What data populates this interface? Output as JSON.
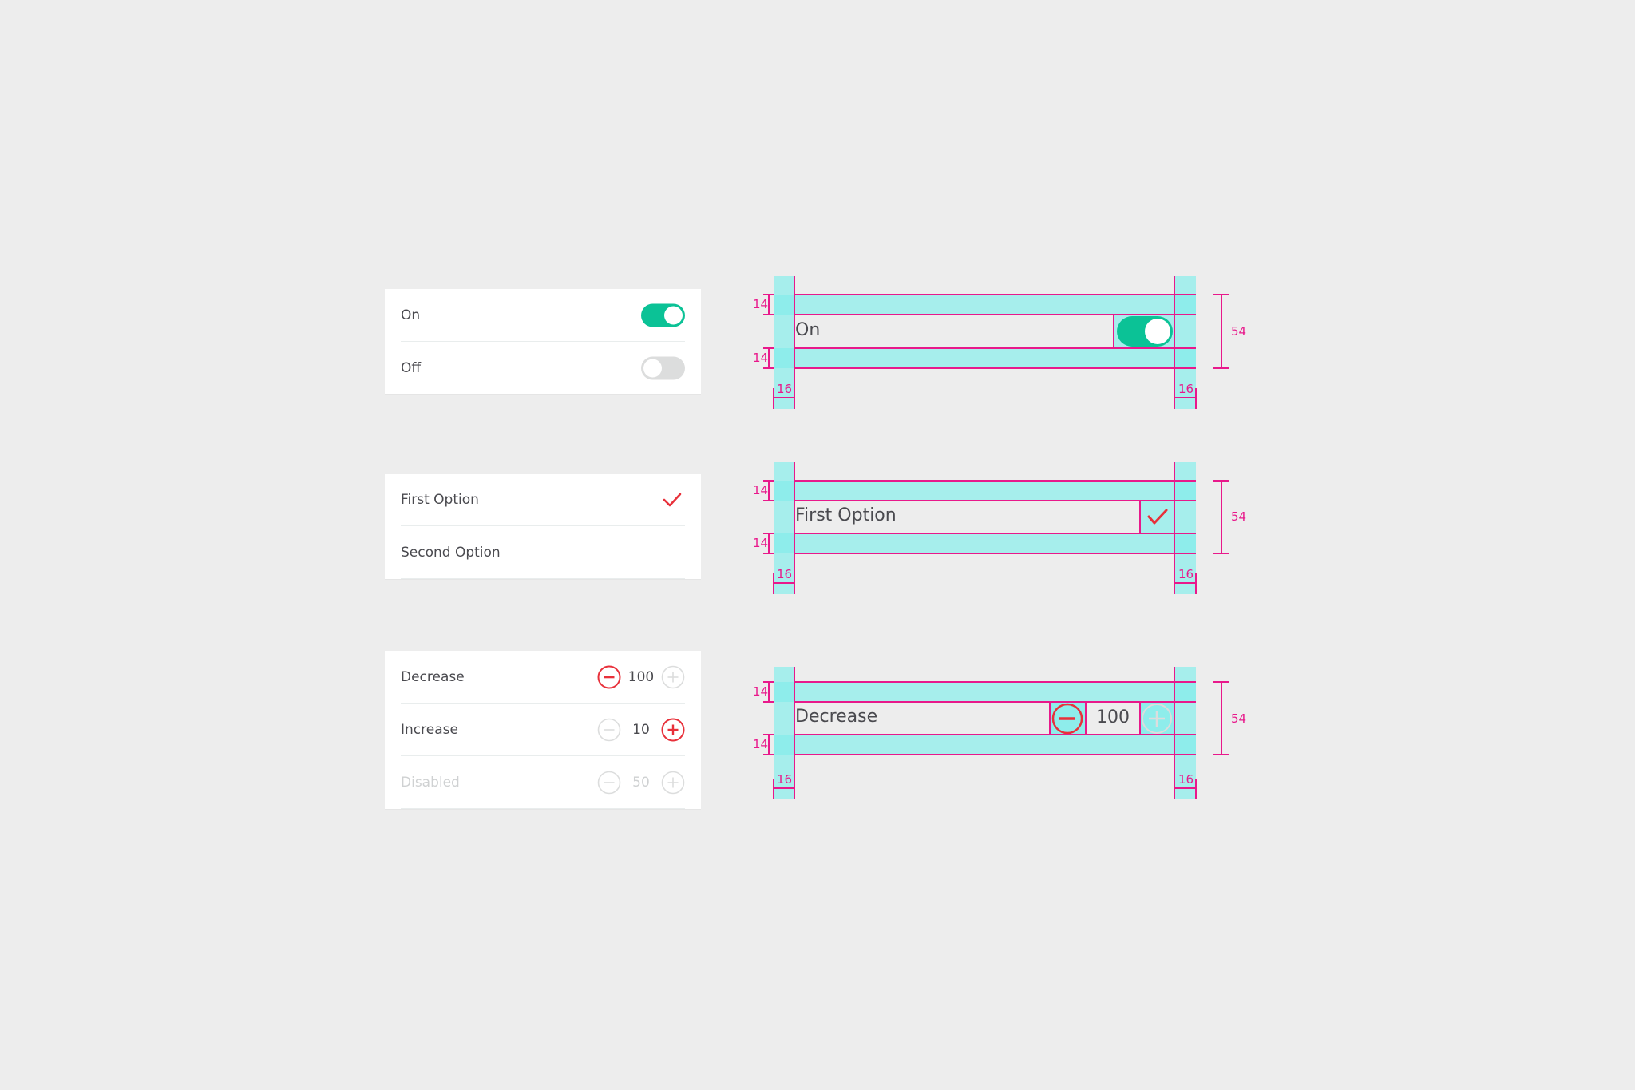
{
  "colors": {
    "background": "#ededed",
    "card": "#ffffff",
    "text": "#4a4a4f",
    "disabled_text": "#cfd1d2",
    "toggle_on": "#0bc296",
    "toggle_off": "#dcdddd",
    "accent_red": "#e8303a",
    "spec_cyan": "#a6eeec",
    "spec_magenta": "#e8198b"
  },
  "toggles_card": {
    "rows": [
      {
        "label": "On",
        "state": "on"
      },
      {
        "label": "Off",
        "state": "off"
      }
    ]
  },
  "options_card": {
    "rows": [
      {
        "label": "First Option",
        "selected": true,
        "icon": "checkmark-icon"
      },
      {
        "label": "Second Option",
        "selected": false
      }
    ]
  },
  "steppers_card": {
    "rows": [
      {
        "label": "Decrease",
        "value": "100",
        "minus_active": true,
        "plus_active": false,
        "disabled": false
      },
      {
        "label": "Increase",
        "value": "10",
        "minus_active": false,
        "plus_active": true,
        "disabled": false
      },
      {
        "label": "Disabled",
        "value": "50",
        "minus_active": false,
        "plus_active": false,
        "disabled": true
      }
    ]
  },
  "specs": {
    "toggle_spec": {
      "label": "On",
      "top_padding": "14",
      "bottom_padding": "14",
      "left_margin": "16",
      "right_margin": "16",
      "row_height": "54"
    },
    "check_spec": {
      "label": "First Option",
      "top_padding": "14",
      "bottom_padding": "14",
      "left_margin": "16",
      "right_margin": "16",
      "row_height": "54"
    },
    "stepper_spec": {
      "label": "Decrease",
      "value": "100",
      "top_padding": "14",
      "bottom_padding": "14",
      "left_margin": "16",
      "right_margin": "16",
      "row_height": "54"
    }
  }
}
